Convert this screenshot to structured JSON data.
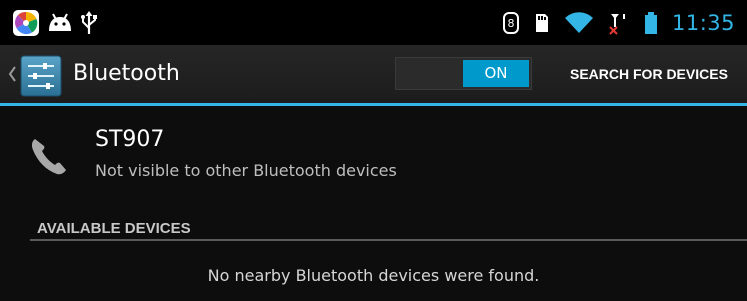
{
  "status_bar": {
    "time": "11:35",
    "left_icons": [
      "launcher-app-icon",
      "android-notification-icon",
      "usb-icon"
    ],
    "right_icons": [
      "sync-icon",
      "sd-card-icon",
      "wifi-icon",
      "no-signal-icon",
      "battery-icon"
    ],
    "clock_color": "#33b5e5"
  },
  "action_bar": {
    "title": "Bluetooth",
    "toggle_state": "ON",
    "search_label": "SEARCH FOR DEVICES",
    "accent": "#33b5e5"
  },
  "device": {
    "name": "ST907",
    "status": "Not visible to other Bluetooth devices",
    "icon": "phone-icon"
  },
  "available": {
    "header": "AVAILABLE DEVICES",
    "empty_message": "No nearby Bluetooth devices were found."
  }
}
